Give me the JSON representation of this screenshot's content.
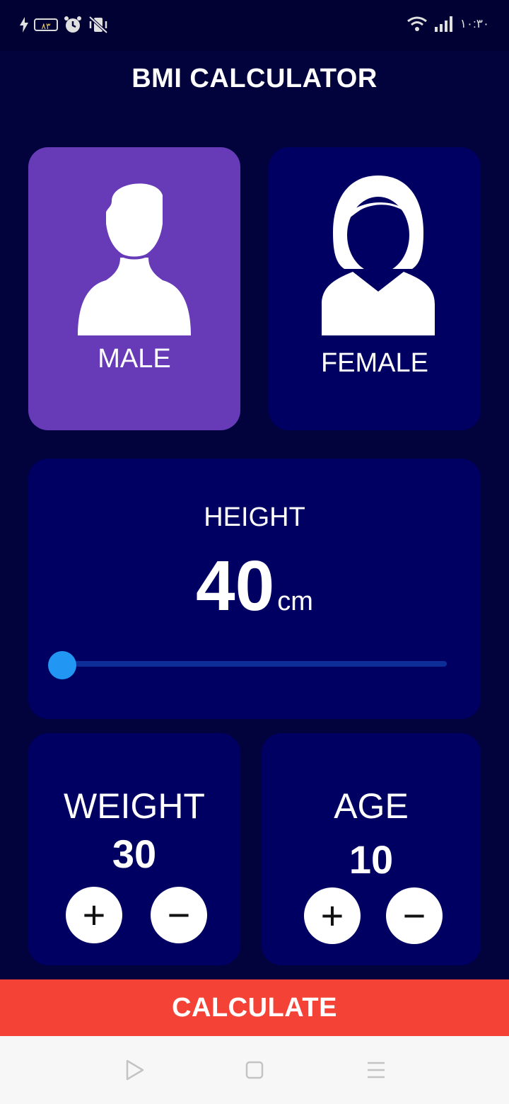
{
  "status_bar": {
    "battery_level": "۸۳",
    "time": "۱۰:۳۰",
    "icons": [
      "bolt-icon",
      "battery-icon",
      "alarm-icon",
      "vibrate-off-icon",
      "wifi-icon",
      "signal-icon"
    ]
  },
  "app": {
    "title": "BMI CALCULATOR"
  },
  "gender": {
    "selected": "male",
    "male_label": "MALE",
    "female_label": "FEMALE"
  },
  "height": {
    "title": "HEIGHT",
    "value": "40",
    "unit": "cm",
    "slider_fraction": 0.0
  },
  "weight": {
    "title": "WEIGHT",
    "value": "30",
    "plus_label": "+",
    "minus_label": "−"
  },
  "age": {
    "title": "AGE",
    "value": "10",
    "plus_label": "+",
    "minus_label": "−"
  },
  "calculate": {
    "label": "CALCULATE"
  },
  "colors": {
    "background": "#02023d",
    "card": "#000063",
    "selected_card": "#673ab7",
    "slider_thumb": "#2196f3",
    "slider_track": "#0d2e99",
    "calculate_button": "#f44336"
  },
  "nav_bar": {
    "icons": [
      "back-triangle-icon",
      "home-square-icon",
      "menu-lines-icon"
    ]
  }
}
